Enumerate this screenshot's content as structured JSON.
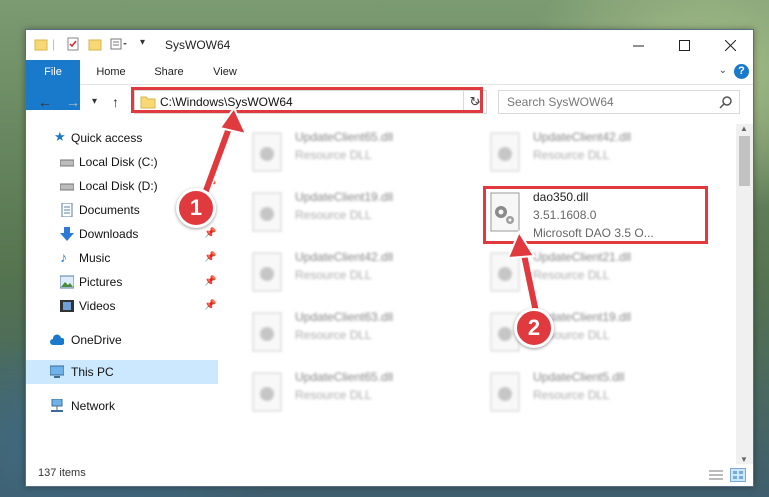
{
  "window": {
    "title": "SysWOW64",
    "minimize_icon": "minimize-icon",
    "maximize_icon": "maximize-icon",
    "close_icon": "close-icon"
  },
  "ribbon": {
    "tabs": [
      "File",
      "Home",
      "Share",
      "View"
    ]
  },
  "nav": {
    "address": "C:\\Windows\\SysWOW64",
    "search_placeholder": "Search SysWOW64"
  },
  "sidebar": {
    "items": [
      {
        "label": "Quick access",
        "icon": "star-icon",
        "pinned": false
      },
      {
        "label": "Local Disk (C:)",
        "icon": "drive-icon",
        "pinned": false
      },
      {
        "label": "Local Disk (D:)",
        "icon": "drive-icon",
        "pinned": true
      },
      {
        "label": "Documents",
        "icon": "document-icon",
        "pinned": true
      },
      {
        "label": "Downloads",
        "icon": "download-icon",
        "pinned": true
      },
      {
        "label": "Music",
        "icon": "music-icon",
        "pinned": true
      },
      {
        "label": "Pictures",
        "icon": "picture-icon",
        "pinned": true
      },
      {
        "label": "Videos",
        "icon": "video-icon",
        "pinned": true
      },
      {
        "label": "OneDrive",
        "icon": "cloud-icon",
        "pinned": false
      },
      {
        "label": "This PC",
        "icon": "computer-icon",
        "pinned": false,
        "selected": true
      },
      {
        "label": "Network",
        "icon": "network-icon",
        "pinned": false
      }
    ]
  },
  "files": [
    {
      "name": "UpdateClient65.dll",
      "type": "Resource DLL"
    },
    {
      "name": "UpdateClient42.dll",
      "type": "Resource DLL"
    },
    {
      "name": "UpdateClient19.dll",
      "type": "Resource DLL"
    },
    {
      "name": "dao350.dll",
      "type": "3.51.1608.0",
      "desc": "Microsoft DAO 3.5 O...",
      "highlighted": true
    },
    {
      "name": "UpdateClient42.dll",
      "type": "Resource DLL"
    },
    {
      "name": "UpdateClient21.dll",
      "type": "Resource DLL"
    },
    {
      "name": "UpdateClient63.dll",
      "type": "Resource DLL"
    },
    {
      "name": "UpdateClient19.dll",
      "type": "Resource DLL"
    },
    {
      "name": "UpdateClient65.dll",
      "type": "Resource DLL"
    },
    {
      "name": "UpdateClient5.dll",
      "type": "Resource DLL"
    }
  ],
  "status": {
    "item_count": "137 items"
  },
  "annotations": {
    "step1": "1",
    "step2": "2",
    "color": "#e0393e"
  },
  "colors": {
    "accent": "#1979ca",
    "selection": "#cce8ff"
  }
}
